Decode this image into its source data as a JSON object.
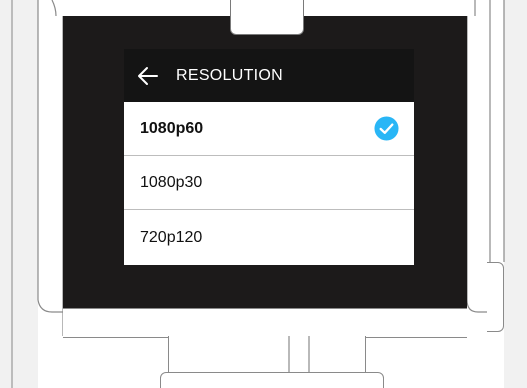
{
  "screen": {
    "header": {
      "title": "RESOLUTION",
      "back_icon": "arrow-left-icon"
    },
    "options": [
      {
        "label": "1080p60",
        "selected": true,
        "check_icon": "checkmark-circle-icon"
      },
      {
        "label": "1080p30",
        "selected": false
      },
      {
        "label": "720p120",
        "selected": false
      }
    ]
  },
  "colors": {
    "check_accent": "#29b6f6",
    "bezel": "#1c1a1a",
    "header_bg": "#141414"
  }
}
